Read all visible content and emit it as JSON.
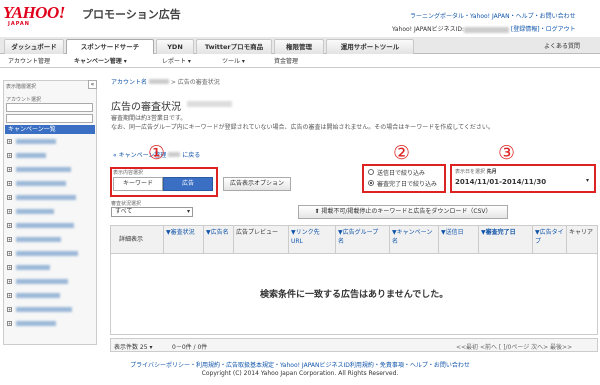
{
  "header": {
    "logo": "YAHOO!",
    "logo_sub": "JAPAN",
    "product": "プロモーション広告",
    "top_links": "ラーニングポータル・Yahoo! JAPAN・ヘルプ・お問い合わせ",
    "user_prefix": "Yahoo! JAPANビジネスID:",
    "user_links": "[登録情報]・ログアウト"
  },
  "tabs": [
    {
      "label": "ダッシュボード"
    },
    {
      "label": "スポンサードサーチ"
    },
    {
      "label": "YDN"
    },
    {
      "label": "Twitterプロモ商品"
    },
    {
      "label": "権限管理"
    },
    {
      "label": "運用サポートツール"
    }
  ],
  "help_link": "よくある質問",
  "subnav": [
    {
      "label": "アカウント管理"
    },
    {
      "label": "キャンペーン管理 ▾"
    },
    {
      "label": "レポート ▾"
    },
    {
      "label": "ツール ▾"
    },
    {
      "label": "資金管理"
    }
  ],
  "sidebar": {
    "title": "表示階層選択",
    "account_label": "アカウント選択",
    "selected_item": "キャンペーン一覧",
    "collapse": "«"
  },
  "main": {
    "breadcrumb_prefix": "アカウント名",
    "breadcrumb_current": "> 広告の審査状況",
    "title": "広告の審査状況",
    "desc_line1": "審査期間は約3営業日です。",
    "desc_line2": "なお、同一広告グループ内にキーワードが登録されていない場合、広告の審査は開始されません。その場合はキーワードを作成してください。",
    "back_link": "« キャンペーン管理",
    "back_link_tail": "に戻る"
  },
  "filters": {
    "display_label": "表示内容選択",
    "keyword_btn": "キーワード",
    "ad_btn": "広告",
    "ad_options_btn": "広告表示オプション",
    "radio1": "送信日で絞り込み",
    "radio2": "審査完了日で絞り込み",
    "period_label": "表示日を選択",
    "period_value": "先月",
    "date_range": "2014/11/01-2014/11/30",
    "status_label": "審査状況選択",
    "status_value": "すべて",
    "download_btn": "掲載不可/掲載停止のキーワードと広告をダウンロード（CSV）",
    "annot1": "①",
    "annot2": "②",
    "annot3": "③"
  },
  "table": {
    "columns": [
      "詳細表示",
      "審査状況",
      "広告名",
      "広告プレビュー",
      "リンク先URL",
      "広告グループ名",
      "キャンペーン名",
      "送信日",
      "審査完了日",
      "広告タイプ",
      "キャリア"
    ],
    "empty_message": "検索条件に一致する広告はありませんでした。",
    "rows_per_page": "表示件数 25 ▾",
    "count": "0－0件 / 0件",
    "pagination": "<<最初 <前へ  [  ]/0ページ 次へ> 最後>>"
  },
  "footer": {
    "links": "プライバシーポリシー・利用規約・広告取扱基本規定・Yahoo! JAPANビジネスID利用規約・免責事項・ヘルプ・お問い合わせ",
    "copyright": "Copyright (C) 2014 Yahoo Japan Corporation. All Rights Reserved."
  },
  "colors": {
    "accent": "#3a6fc4",
    "annotation": "#dd2222",
    "brand": "#e0001b"
  }
}
